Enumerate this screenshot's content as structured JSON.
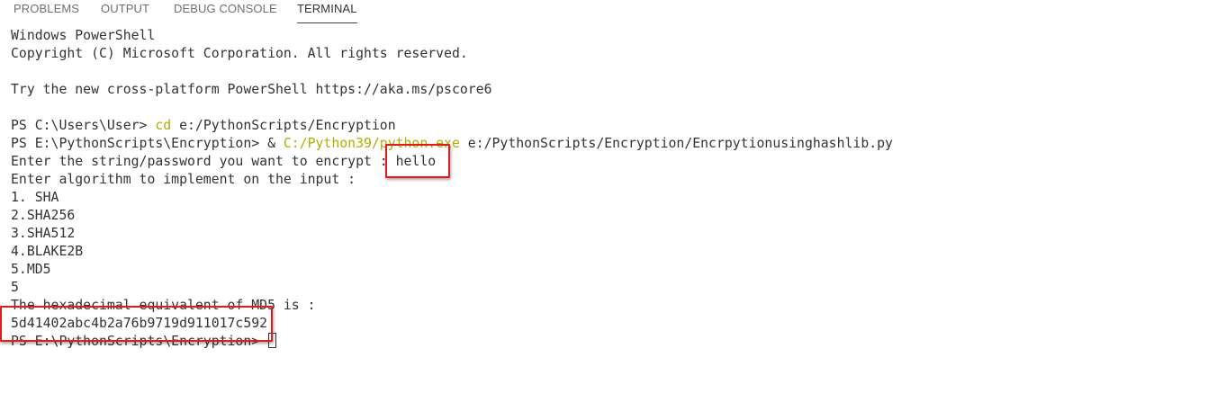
{
  "tabs": [
    {
      "label": "PROBLEMS"
    },
    {
      "label": "OUTPUT"
    },
    {
      "label": "DEBUG CONSOLE"
    },
    {
      "label": "TERMINAL",
      "active": true
    }
  ],
  "terminal": {
    "lines": {
      "l0": "Windows PowerShell",
      "l1": "Copyright (C) Microsoft Corporation. All rights reserved.",
      "l2": "",
      "l3": "Try the new cross-platform PowerShell https://aka.ms/pscore6",
      "l4": ""
    },
    "cmd1": {
      "prompt": "PS C:\\Users\\User> ",
      "command": "cd",
      "args": " e:/PythonScripts/Encryption"
    },
    "cmd2": {
      "prompt": "PS E:\\PythonScripts\\Encryption> & ",
      "exe": "C:/Python39/python.exe",
      "args": " e:/PythonScripts/Encryption/Encrpytionusinghashlib.py"
    },
    "input_prompt": "Enter the string/password you want to encrypt : ",
    "input_value": "hello",
    "algo_prompt": "Enter algorithm to implement on the input :",
    "options": [
      "1. SHA",
      "2.SHA256",
      "3.SHA512",
      "4.BLAKE2B",
      "5.MD5"
    ],
    "choice": "5",
    "result_label": "The hexadecimal equivalent of MD5 is :",
    "result_hash": "5d41402abc4b2a76b9719d911017c592",
    "final_prompt": "PS E:\\PythonScripts\\Encryption> "
  },
  "colors": {
    "command": "#b3ab00",
    "highlight_box": "#e01b1b",
    "text": "#333333"
  }
}
